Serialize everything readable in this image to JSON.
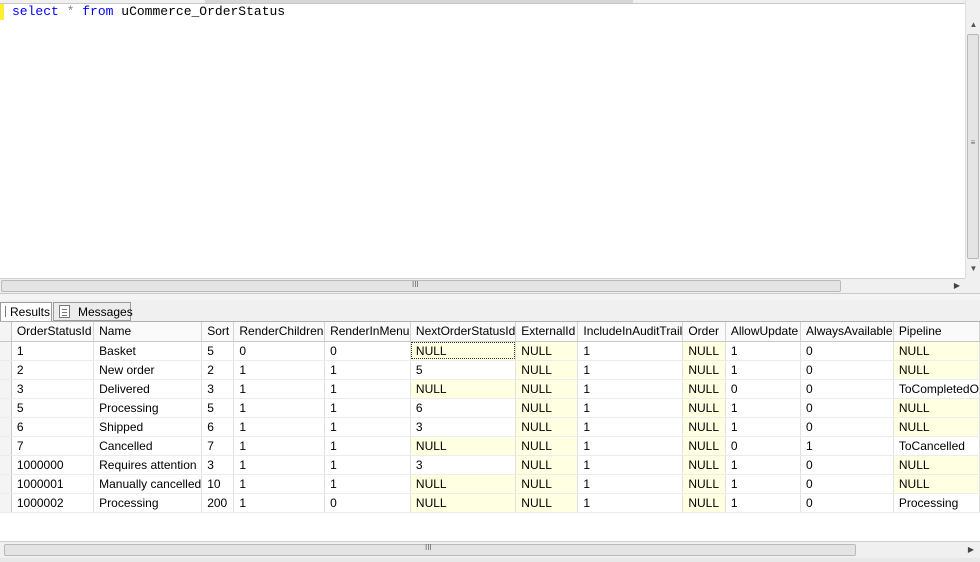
{
  "editor": {
    "query": {
      "kw_select": "select",
      "star": "*",
      "kw_from": "from",
      "table": "uCommerce_OrderStatus"
    },
    "scroll_grip": "III"
  },
  "tabs": [
    {
      "label": "Results",
      "icon": "grid-icon"
    },
    {
      "label": "Messages",
      "icon": "messages-icon"
    }
  ],
  "grid": {
    "columns": [
      "OrderStatusId",
      "Name",
      "Sort",
      "RenderChildren",
      "RenderInMenu",
      "NextOrderStatusId",
      "ExternalId",
      "IncludeInAuditTrail",
      "Order",
      "AllowUpdate",
      "AlwaysAvailable",
      "Pipeline"
    ],
    "rows": [
      [
        "1",
        "Basket",
        "5",
        "0",
        "0",
        "NULL",
        "NULL",
        "1",
        "NULL",
        "1",
        "0",
        "NULL"
      ],
      [
        "2",
        "New order",
        "2",
        "1",
        "1",
        "5",
        "NULL",
        "1",
        "NULL",
        "1",
        "0",
        "NULL"
      ],
      [
        "3",
        "Delivered",
        "3",
        "1",
        "1",
        "NULL",
        "NULL",
        "1",
        "NULL",
        "0",
        "0",
        "ToCompletedO"
      ],
      [
        "5",
        "Processing",
        "5",
        "1",
        "1",
        "6",
        "NULL",
        "1",
        "NULL",
        "1",
        "0",
        "NULL"
      ],
      [
        "6",
        "Shipped",
        "6",
        "1",
        "1",
        "3",
        "NULL",
        "1",
        "NULL",
        "1",
        "0",
        "NULL"
      ],
      [
        "7",
        "Cancelled",
        "7",
        "1",
        "1",
        "NULL",
        "NULL",
        "1",
        "NULL",
        "0",
        "1",
        "ToCancelled"
      ],
      [
        "1000000",
        "Requires attention",
        "3",
        "1",
        "1",
        "3",
        "NULL",
        "1",
        "NULL",
        "1",
        "0",
        "NULL"
      ],
      [
        "1000001",
        "Manually cancelled",
        "10",
        "1",
        "1",
        "NULL",
        "NULL",
        "1",
        "NULL",
        "1",
        "0",
        "NULL"
      ],
      [
        "1000002",
        "Processing",
        "200",
        "1",
        "0",
        "NULL",
        "NULL",
        "1",
        "NULL",
        "1",
        "0",
        "Processing"
      ]
    ],
    "null_color": "#ffffe1",
    "scroll_grip": "III"
  },
  "colors": {
    "keyword": "#0000ff",
    "margin_marker": "#ffee33"
  }
}
